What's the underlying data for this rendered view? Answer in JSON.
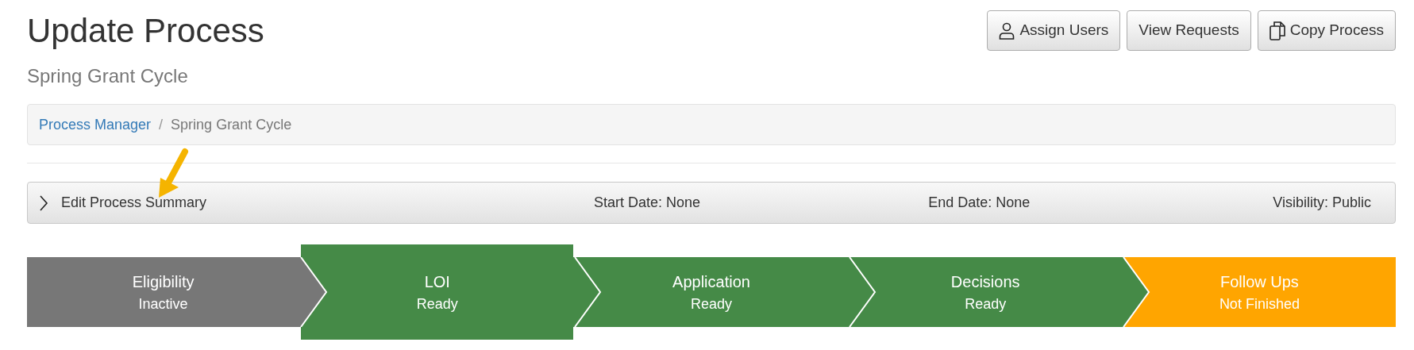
{
  "page": {
    "title": "Update Process",
    "subtitle": "Spring Grant Cycle"
  },
  "buttons": [
    {
      "label": "Assign Users",
      "kind": "user"
    },
    {
      "label": "View Requests",
      "kind": "plain"
    },
    {
      "label": "Copy Process",
      "kind": "copy"
    }
  ],
  "breadcrumb": {
    "separator": "/",
    "items": [
      {
        "label": "Process Manager",
        "kind": "link"
      },
      {
        "label": "Spring Grant Cycle",
        "kind": "current"
      }
    ]
  },
  "summary": {
    "toggle": "Edit Process Summary",
    "expanded": false,
    "start_date": "Start Date: None",
    "end_date": "End Date: None",
    "visibility": "Visibility: Public"
  },
  "steps": [
    {
      "name": "Eligibility",
      "status": "Inactive",
      "color": "#777777",
      "selected": false
    },
    {
      "name": "LOI",
      "status": "Ready",
      "color": "#458a47",
      "selected": true
    },
    {
      "name": "Application",
      "status": "Ready",
      "color": "#458a47",
      "selected": false
    },
    {
      "name": "Decisions",
      "status": "Ready",
      "color": "#458a47",
      "selected": false
    },
    {
      "name": "Follow Ups",
      "status": "Not Finished",
      "color": "#ffa500",
      "selected": false
    }
  ]
}
